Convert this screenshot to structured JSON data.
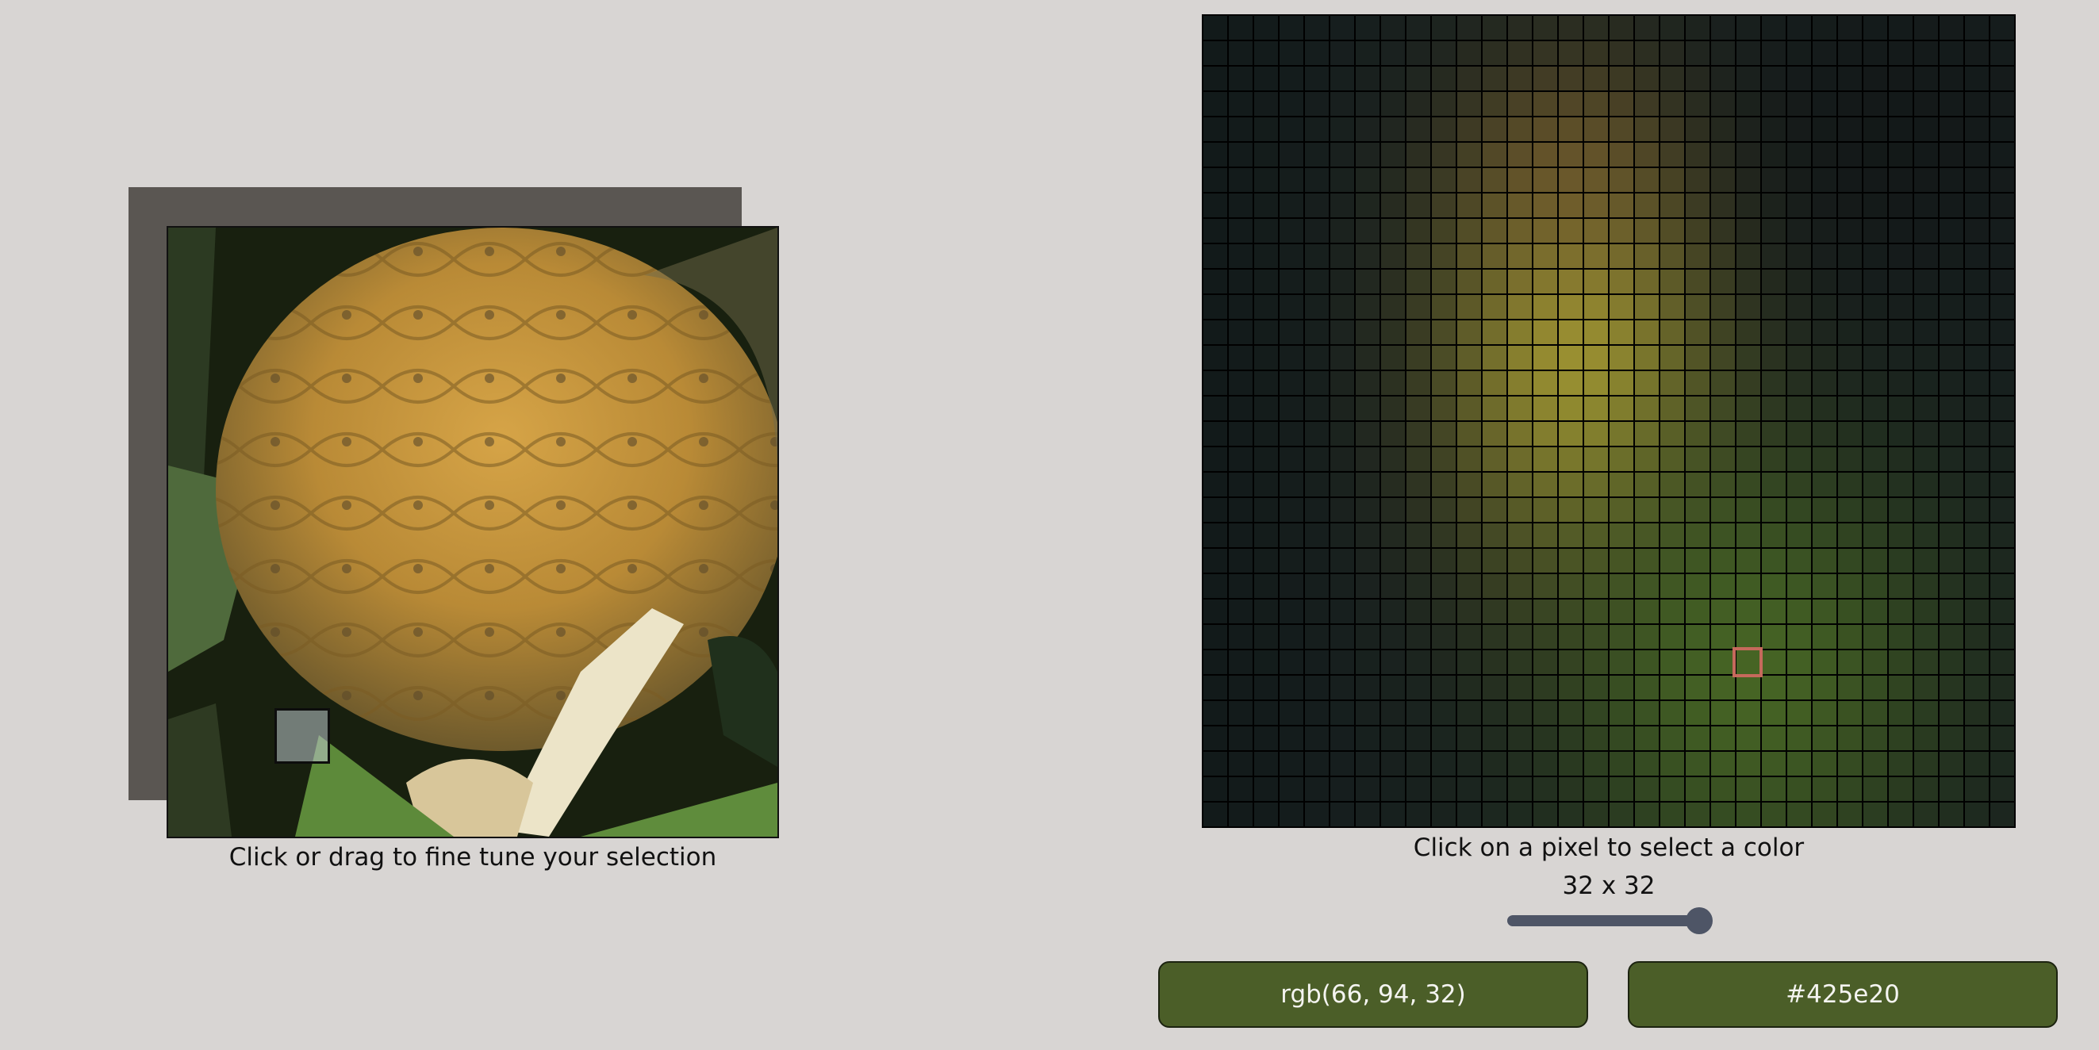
{
  "left_panel": {
    "caption": "Click or drag to fine tune your selection"
  },
  "right_panel": {
    "caption": "Click on a pixel to select a color",
    "grid_size_label": "32 x 32",
    "grid_columns": 32,
    "grid_rows": 32,
    "slider_value_fraction": 1.0,
    "selected_pixel": {
      "column": 21,
      "row": 25
    }
  },
  "color_output": {
    "rgb_label": "rgb(66, 94, 32)",
    "hex_label": "#425e20",
    "selected_color": "#425e20"
  },
  "colors": {
    "background": "#d8d5d3",
    "button_fill": "#4b5e28",
    "cursor_outline": "#c66a5c",
    "slider": "#4e5566"
  }
}
